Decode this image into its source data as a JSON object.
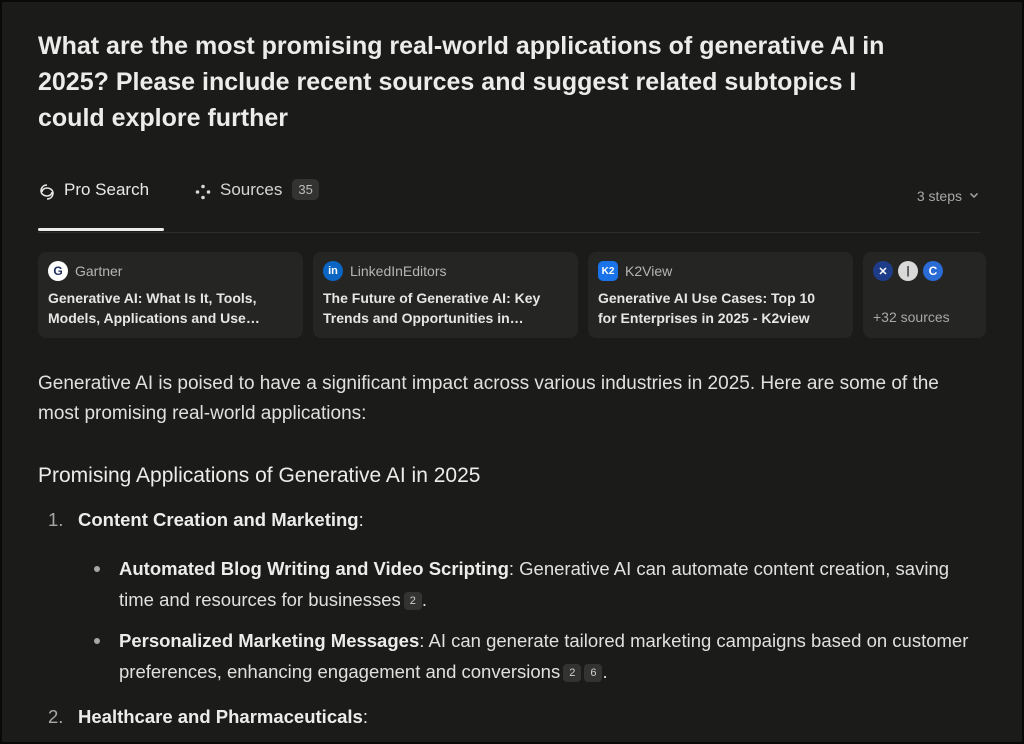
{
  "query": "What are the most promising real-world applications of generative AI in 2025? Please include recent sources and suggest related subtopics I could explore further",
  "tabs": {
    "pro_search": "Pro Search",
    "sources": "Sources",
    "sources_count": "35",
    "steps": "3 steps"
  },
  "source_cards": [
    {
      "site": "Gartner",
      "icon": "gartner-icon",
      "title": "Generative AI: What Is It, Tools,\nModels, Applications and Use…"
    },
    {
      "site": "LinkedInEditors",
      "icon": "linkedin-icon",
      "title": "The Future of Generative AI: Key\nTrends and Opportunities in…"
    },
    {
      "site": "K2View",
      "icon": "k2view-icon",
      "title": "Generative AI Use Cases: Top 10\nfor Enterprises in 2025 - K2view"
    }
  ],
  "more_sources": {
    "label": "+32  sources"
  },
  "answer": {
    "intro": "Generative AI is poised to have a significant impact across various industries in 2025. Here are some of the most promising real-world applications:",
    "heading": "Promising Applications of Generative AI in 2025",
    "items": [
      {
        "number": "1.",
        "title": "Content Creation and Marketing",
        "bullets": [
          {
            "bold": "Automated Blog Writing and Video Scripting",
            "text": ": Generative AI can automate content creation, saving time and resources for businesses",
            "cites": [
              "2"
            ]
          },
          {
            "bold": "Personalized Marketing Messages",
            "text": ": AI can generate tailored marketing campaigns based on customer preferences, enhancing engagement and conversions",
            "cites": [
              "2",
              "6"
            ]
          }
        ]
      },
      {
        "number": "2.",
        "title": "Healthcare and Pharmaceuticals"
      }
    ]
  },
  "colors": {
    "background": "#1b1b1a",
    "card": "#252524",
    "accent": "#ececea"
  }
}
